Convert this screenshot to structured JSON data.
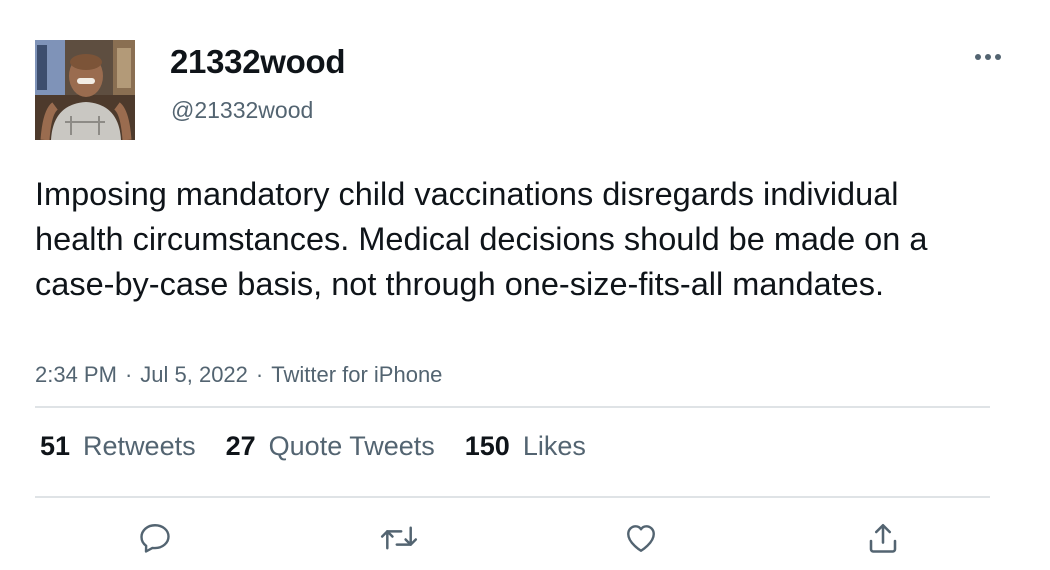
{
  "tweet": {
    "author": {
      "display_name": "21332wood",
      "handle": "@21332wood",
      "avatar_icon": "profile-photo"
    },
    "text": "Imposing mandatory child vaccinations disregards individual health circumstances. Medical decisions should be made on a case-by-case basis, not through one-size-fits-all mandates.",
    "time": "2:34 PM",
    "date": "Jul 5, 2022",
    "separator": "·",
    "source": "Twitter for iPhone",
    "stats": {
      "retweets_count": "51",
      "retweets_label": "Retweets",
      "quotes_count": "27",
      "quotes_label": "Quote Tweets",
      "likes_count": "150",
      "likes_label": "Likes"
    },
    "actions": [
      "reply-icon",
      "retweet-icon",
      "like-icon",
      "share-icon"
    ],
    "more_icon": "more-icon"
  },
  "colors": {
    "text_primary": "#0f1419",
    "text_secondary": "#536471",
    "divider": "#dfe3e6",
    "icon": "#536471"
  }
}
